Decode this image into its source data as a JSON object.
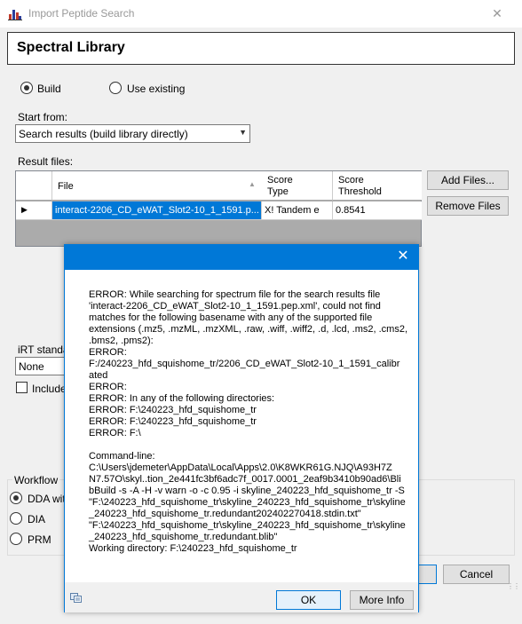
{
  "window": {
    "title": "Import Peptide Search",
    "close_glyph": "✕"
  },
  "header": {
    "title": "Spectral Library"
  },
  "build_radio": {
    "label": "Build",
    "checked": true
  },
  "use_existing_radio": {
    "label": "Use existing",
    "checked": false
  },
  "start_from": {
    "label": "Start from:",
    "value": "Search results (build library directly)"
  },
  "result_files": {
    "label": "Result files:",
    "columns": [
      "File",
      "Score\nType",
      "Score\nThreshold"
    ],
    "rows": [
      {
        "file": "interact-2206_CD_eWAT_Slot2-10_1_1591.p...",
        "score_type": "X! Tandem e",
        "threshold": "0.8541"
      }
    ]
  },
  "add_files_button": "Add Files...",
  "remove_files_button": "Remove Files",
  "irt": {
    "label": "iRT standa",
    "value": "None"
  },
  "include_checkbox": {
    "label": "Include",
    "checked": false
  },
  "workflow": {
    "label": "Workflow",
    "options": [
      {
        "label": "DDA with",
        "checked": true
      },
      {
        "label": "DIA",
        "checked": false
      },
      {
        "label": "PRM",
        "checked": false
      }
    ]
  },
  "cancel_button": "Cancel",
  "dialog": {
    "close_glyph": "✕",
    "message": "ERROR: While searching for spectrum file for the search results file\n'interact-2206_CD_eWAT_Slot2-10_1_1591.pep.xml', could not find\nmatches for the following basename with any of the supported file\nextensions (.mz5, .mzML, .mzXML, .raw, .wiff, .wiff2, .d, .lcd, .ms2, .cms2,\n.bms2, .pms2):\nERROR:\nF:/240223_hfd_squishome_tr/2206_CD_eWAT_Slot2-10_1_1591_calibr\nated\nERROR:\nERROR: In any of the following directories:\nERROR: F:\\240223_hfd_squishome_tr\nERROR: F:\\240223_hfd_squishome_tr\nERROR: F:\\\n\nCommand-line:\nC:\\Users\\jdemeter\\AppData\\Local\\Apps\\2.0\\K8WKR61G.NJQ\\A93H7Z\nN7.57O\\skyl..tion_2e441fc3bf6adc7f_0017.0001_2eaf9b3410b90ad6\\Bli\nbBuild -s -A -H -v warn -o -c 0.95 -i skyline_240223_hfd_squishome_tr -S\n\"F:\\240223_hfd_squishome_tr\\skyline_240223_hfd_squishome_tr\\skyline\n_240223_hfd_squishome_tr.redundant202402270418.stdin.txt\"\n\"F:\\240223_hfd_squishome_tr\\skyline_240223_hfd_squishome_tr\\skyline\n_240223_hfd_squishome_tr.redundant.blib\"\nWorking directory: F:\\240223_hfd_squishome_tr",
    "ok_button": "OK",
    "more_info_button": "More Info"
  },
  "colors": {
    "accent": "#0078d7",
    "selection": "#0078d7",
    "grid_empty": "#ababab"
  }
}
